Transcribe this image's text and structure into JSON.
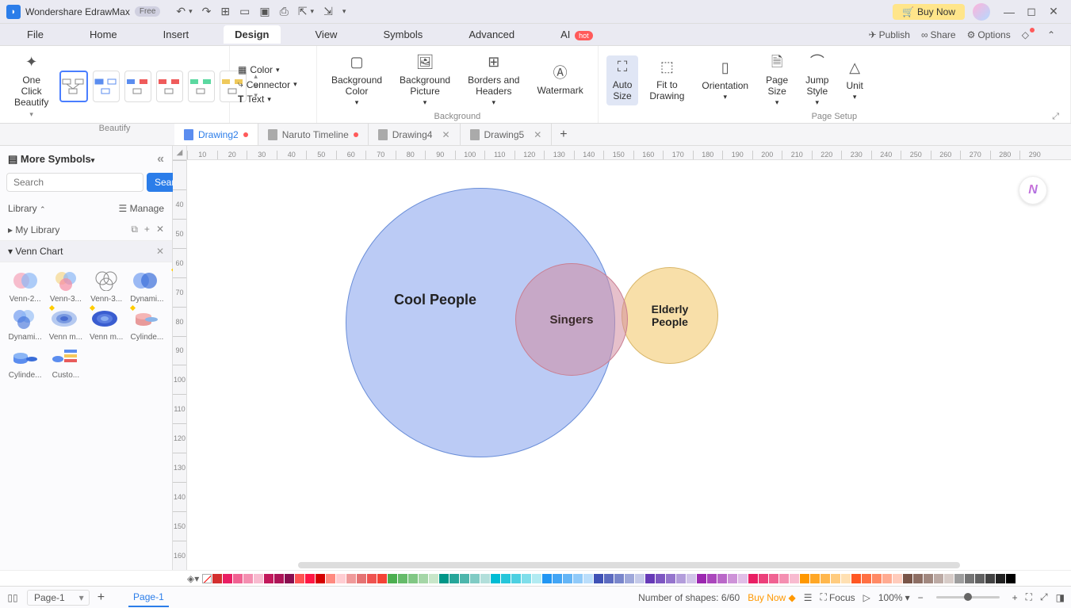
{
  "app": {
    "name": "Wondershare EdrawMax",
    "badge": "Free",
    "buynow": "Buy Now"
  },
  "menu": {
    "items": [
      "File",
      "Home",
      "Insert",
      "Design",
      "View",
      "Symbols",
      "Advanced"
    ],
    "ai": "AI",
    "ai_tag": "hot",
    "publish": "Publish",
    "share": "Share",
    "options": "Options"
  },
  "ribbon": {
    "oneclick": "One Click\nBeautify",
    "beautify_label": "Beautify",
    "color": "Color",
    "connector": "Connector",
    "text": "Text",
    "bgcolor": "Background\nColor",
    "bgpic": "Background\nPicture",
    "borders": "Borders and\nHeaders",
    "watermark": "Watermark",
    "background_label": "Background",
    "autosize": "Auto\nSize",
    "fit": "Fit to\nDrawing",
    "orientation": "Orientation",
    "pagesize": "Page\nSize",
    "jump": "Jump\nStyle",
    "unit": "Unit",
    "pagesetup_label": "Page Setup"
  },
  "tabs": [
    {
      "label": "Drawing2",
      "active": true,
      "dirty": true
    },
    {
      "label": "Naruto Timeline",
      "active": false,
      "dirty": true
    },
    {
      "label": "Drawing4",
      "active": false,
      "closable": true
    },
    {
      "label": "Drawing5",
      "active": false,
      "closable": true
    }
  ],
  "sidebar": {
    "title": "More Symbols",
    "search_placeholder": "Search",
    "search_btn": "Search",
    "library": "Library",
    "manage": "Manage",
    "mylib": "My Library",
    "category": "Venn Chart",
    "symbols": [
      "Venn-2...",
      "Venn-3...",
      "Venn-3...",
      "Dynami...",
      "Dynami...",
      "Venn m...",
      "Venn m...",
      "Cylinde...",
      "Cylinde...",
      "Custo..."
    ]
  },
  "ruler_h": [
    "10",
    "20",
    "30",
    "40",
    "50",
    "60",
    "70",
    "80",
    "90",
    "100",
    "110",
    "120",
    "130",
    "140",
    "150",
    "160",
    "170",
    "180",
    "190",
    "200",
    "210",
    "220",
    "230",
    "240",
    "250",
    "260",
    "270",
    "280",
    "290"
  ],
  "ruler_v": [
    "",
    "40",
    "50",
    "60",
    "70",
    "80",
    "90",
    "100",
    "110",
    "120",
    "130",
    "140",
    "150",
    "160"
  ],
  "chart_data": {
    "type": "venn",
    "circles": [
      {
        "label": "Cool People",
        "cx_mm": 80,
        "cy_mm": 90,
        "r_mm": 45,
        "fill": "#b3c6f5",
        "stroke": "#6a8ed8"
      },
      {
        "label": "Elderly People",
        "cx_mm": 166,
        "cy_mm": 90,
        "r_mm": 17,
        "fill": "#f7dca0",
        "stroke": "#d8b66a"
      },
      {
        "label": "Singers",
        "cx_mm": 135,
        "cy_mm": 90,
        "r_mm": 19,
        "fill": "#e3b5c0",
        "stroke": "#c97f92",
        "opacity": 0.7
      }
    ]
  },
  "colors": [
    "#d32f2f",
    "#e91e63",
    "#f06292",
    "#f48fb1",
    "#f8bbd0",
    "#c2185b",
    "#ad1457",
    "#880e4f",
    "#ff5252",
    "#ff1744",
    "#d50000",
    "#ff8a80",
    "#ffcdd2",
    "#ef9a9a",
    "#e57373",
    "#ef5350",
    "#f44336",
    "#4caf50",
    "#66bb6a",
    "#81c784",
    "#a5d6a7",
    "#c8e6c9",
    "#009688",
    "#26a69a",
    "#4db6ac",
    "#80cbc4",
    "#b2dfdb",
    "#00bcd4",
    "#26c6da",
    "#4dd0e1",
    "#80deea",
    "#b2ebf2",
    "#2196f3",
    "#42a5f5",
    "#64b5f6",
    "#90caf9",
    "#bbdefb",
    "#3f51b5",
    "#5c6bc0",
    "#7986cb",
    "#9fa8da",
    "#c5cae9",
    "#673ab7",
    "#7e57c2",
    "#9575cd",
    "#b39ddb",
    "#d1c4e9",
    "#9c27b0",
    "#ab47bc",
    "#ba68c8",
    "#ce93d8",
    "#e1bee7",
    "#e91e63",
    "#ec407a",
    "#f06292",
    "#f48fb1",
    "#f8bbd0",
    "#ff9800",
    "#ffa726",
    "#ffb74d",
    "#ffcc80",
    "#ffe0b2",
    "#ff5722",
    "#ff7043",
    "#ff8a65",
    "#ffab91",
    "#ffccbc",
    "#795548",
    "#8d6e63",
    "#a1887f",
    "#bcaaa4",
    "#d7ccc8",
    "#9e9e9e",
    "#757575",
    "#616161",
    "#424242",
    "#212121",
    "#000000",
    "#ffffff"
  ],
  "status": {
    "page": "Page-1",
    "pagetab": "Page-1",
    "shapes": "Number of shapes: 6/60",
    "buynow": "Buy Now",
    "focus": "Focus",
    "zoom": "100%"
  }
}
